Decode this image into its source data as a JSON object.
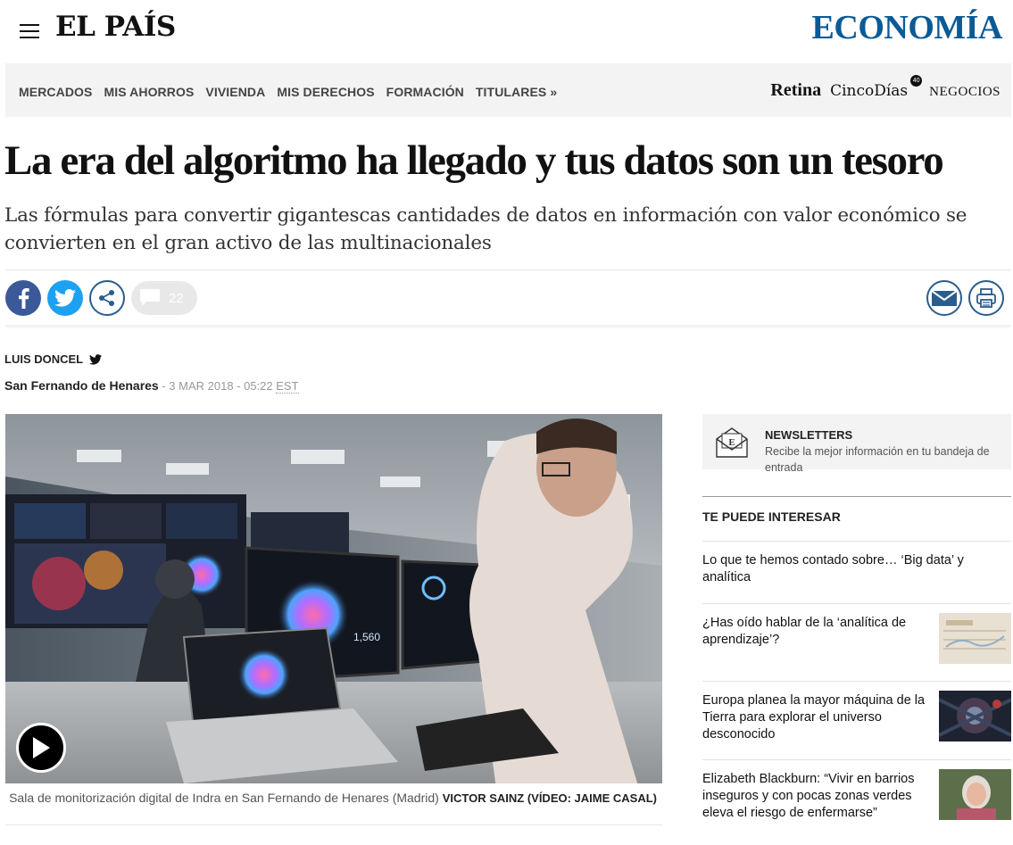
{
  "header": {
    "logo": "EL PAÍS",
    "section": "ECONOMÍA",
    "menu_icon": "hamburger-icon"
  },
  "subnav": {
    "items": [
      "MERCADOS",
      "MIS AHORROS",
      "VIVIENDA",
      "MIS DERECHOS",
      "FORMACIÓN",
      "TITULARES »"
    ],
    "partners": {
      "retina": "Retina",
      "cincodias": "CincoDías",
      "cincodias_badge": "40",
      "negocios": "NEGOCIOS"
    }
  },
  "article": {
    "headline": "La era del algoritmo ha llegado y tus datos son un tesoro",
    "subheadline": "Las fórmulas para convertir gigantescas cantidades de datos en información con valor económico se convierten en el gran activo de las multinacionales",
    "author": "LUIS DONCEL",
    "place": "San Fernando de Henares",
    "date_sep": " - ",
    "date": "3 MAR 2018 - 05:22",
    "tz": "EST",
    "comment_count": "22",
    "caption": "Sala de monitorización digital de Indra en San Fernando de Henares (Madrid)",
    "credit": "VICTOR SAINZ (VÍDEO: JAIME CASAL)",
    "photo_screen_number": "1,560"
  },
  "share": {
    "icons": [
      "facebook-icon",
      "twitter-icon",
      "share-icon",
      "comment-icon",
      "mail-icon",
      "print-icon"
    ]
  },
  "colors": {
    "facebook": "#3b5998",
    "twitter": "#1da1f2",
    "accent": "#2a5d8c",
    "section": "#0a5a95"
  },
  "sidebar": {
    "newsletter": {
      "title": "NEWSLETTERS",
      "text": "Recibe la mejor información en tu bandeja de entrada"
    },
    "title": "TE PUEDE INTERESAR",
    "items": [
      {
        "text": "Lo que te hemos contado sobre… ‘Big data’ y analítica"
      },
      {
        "text": "¿Has oído hablar de la ‘analítica de aprendizaje’?"
      },
      {
        "text": "Europa planea la mayor máquina de la Tierra para explorar el universo desconocido"
      },
      {
        "text": "Elizabeth Blackburn: “Vivir en barrios inseguros y con pocas zonas verdes eleva el riesgo de enfermarse”"
      }
    ]
  }
}
